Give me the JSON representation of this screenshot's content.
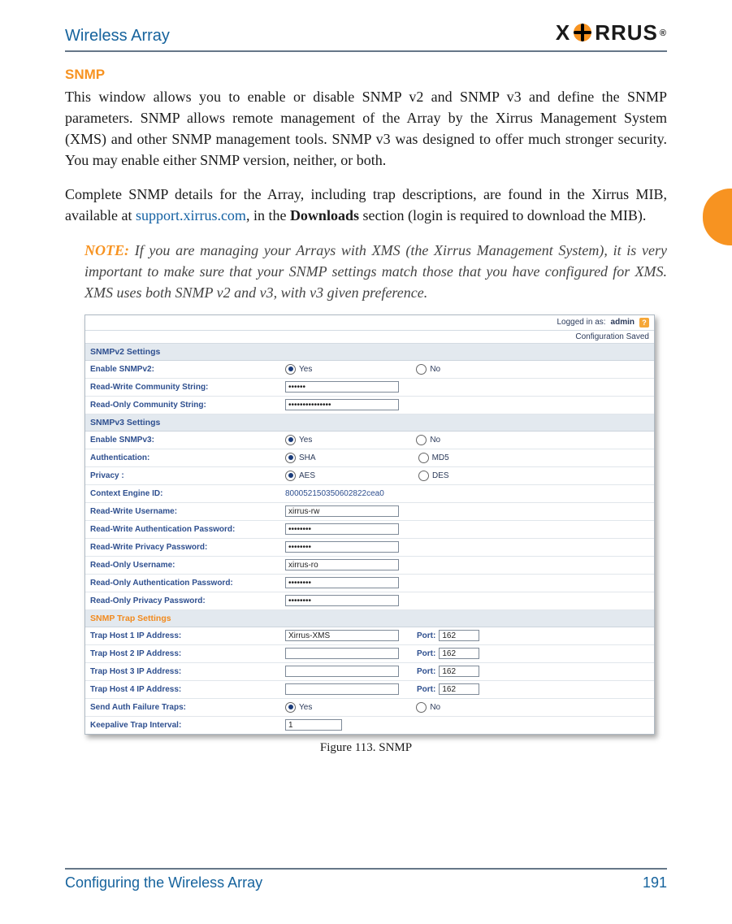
{
  "header": {
    "title": "Wireless Array",
    "logo_text_1": "X",
    "logo_text_2": "RRUS",
    "logo_reg": "®"
  },
  "section_heading": "SNMP",
  "para1": "This window allows you to enable or disable SNMP v2 and SNMP v3 and define the SNMP parameters. SNMP allows remote management of the Array by the Xirrus Management System (XMS) and other SNMP management tools. SNMP v3 was designed to offer much stronger security. You may enable either SNMP version, neither, or both.",
  "para2_pre": "Complete SNMP details for the Array, including trap descriptions, are found in the Xirrus MIB, available at ",
  "para2_link": "support.xirrus.com",
  "para2_mid": ", in the ",
  "para2_strong": "Downloads",
  "para2_post": " section (login is required to download the MIB).",
  "note_tag": "NOTE:",
  "note_body": " If you are managing your Arrays with XMS (the Xirrus Management System), it is very important to make sure that your SNMP settings match those that you have configured for XMS. XMS uses both SNMP v2 and v3, with v3 given preference.",
  "panel": {
    "top": {
      "logged_in_as": "Logged in as:",
      "user": "admin",
      "help_glyph": "?"
    },
    "config_saved": "Configuration Saved",
    "snmpv2": {
      "header": "SNMPv2 Settings",
      "enable_label": "Enable SNMPv2:",
      "enable_yes": "Yes",
      "enable_no": "No",
      "enable_value": "Yes",
      "rw_comm_label": "Read-Write Community String:",
      "rw_comm_value": "••••••",
      "ro_comm_label": "Read-Only Community String:",
      "ro_comm_value": "•••••••••••••••"
    },
    "snmpv3": {
      "header": "SNMPv3 Settings",
      "enable_label": "Enable SNMPv3:",
      "enable_yes": "Yes",
      "enable_no": "No",
      "enable_value": "Yes",
      "auth_label": "Authentication:",
      "auth_sha": "SHA",
      "auth_md5": "MD5",
      "auth_value": "SHA",
      "priv_label": "Privacy :",
      "priv_aes": "AES",
      "priv_des": "DES",
      "priv_value": "AES",
      "engine_label": "Context Engine ID:",
      "engine_value": "800052150350602822cea0",
      "rw_user_label": "Read-Write Username:",
      "rw_user_value": "xirrus-rw",
      "rw_auth_label": "Read-Write Authentication Password:",
      "rw_auth_value": "••••••••",
      "rw_priv_label": "Read-Write Privacy Password:",
      "rw_priv_value": "••••••••",
      "ro_user_label": "Read-Only Username:",
      "ro_user_value": "xirrus-ro",
      "ro_auth_label": "Read-Only Authentication Password:",
      "ro_auth_value": "••••••••",
      "ro_priv_label": "Read-Only Privacy Password:",
      "ro_priv_value": "••••••••"
    },
    "traps": {
      "header": "SNMP Trap Settings",
      "port_label": "Port:",
      "host1_label": "Trap Host 1 IP Address:",
      "host1_ip": "Xirrus-XMS",
      "host1_port": "162",
      "host2_label": "Trap Host 2 IP Address:",
      "host2_ip": "",
      "host2_port": "162",
      "host3_label": "Trap Host 3 IP Address:",
      "host3_ip": "",
      "host3_port": "162",
      "host4_label": "Trap Host 4 IP Address:",
      "host4_ip": "",
      "host4_port": "162",
      "auth_fail_label": "Send Auth Failure Traps:",
      "auth_fail_yes": "Yes",
      "auth_fail_no": "No",
      "auth_fail_value": "Yes",
      "keepalive_label": "Keepalive Trap Interval:",
      "keepalive_value": "1"
    }
  },
  "figure_caption": "Figure 113. SNMP",
  "footer": {
    "left": "Configuring the Wireless Array",
    "right": "191"
  }
}
